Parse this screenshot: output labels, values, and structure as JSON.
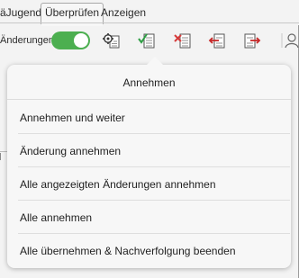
{
  "tabs": {
    "jugend": "äJugend",
    "ueberpruefen": "Überprüfen",
    "anzeigen": "Anzeigen"
  },
  "toolbar": {
    "track_changes_label": "Änderungen",
    "track_changes_on": true,
    "toggle_color": "#4caf50",
    "icons": [
      "settings-gear-icon",
      "accept-change-icon",
      "reject-change-icon",
      "previous-change-icon",
      "next-change-icon",
      "person-icon"
    ]
  },
  "popover": {
    "title": "Annehmen",
    "items": [
      {
        "label": "Annehmen und weiter"
      },
      {
        "label": "Änderung annehmen"
      },
      {
        "label": "Alle angezeigten Änderungen annehmen"
      },
      {
        "label": "Alle annehmen"
      },
      {
        "label": "Alle übernehmen & Nachverfolgung beenden"
      }
    ]
  }
}
